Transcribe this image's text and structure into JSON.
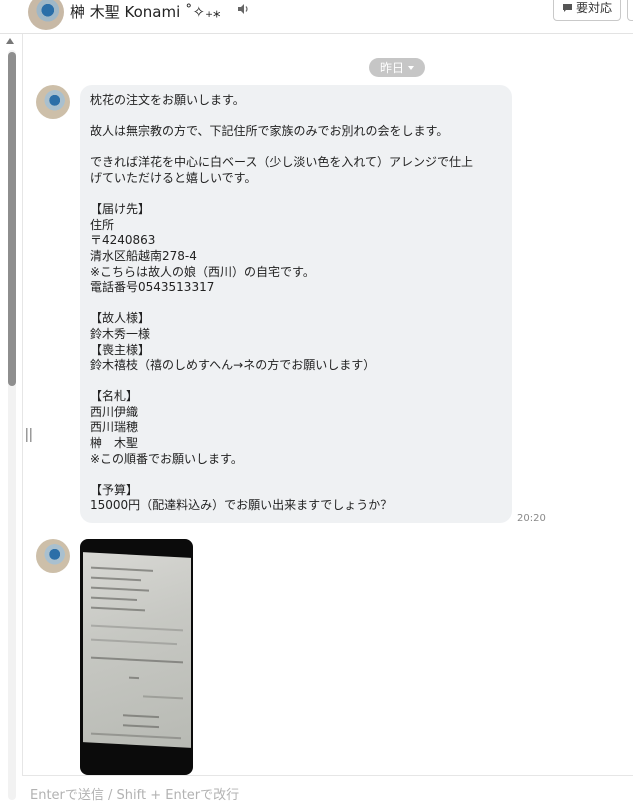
{
  "header": {
    "contact_name": "榊 木聖  Konami ˚✧₊⁎",
    "status_button_label": "要対応"
  },
  "chat": {
    "date_separator": "昨日",
    "messages": [
      {
        "lines": [
          "枕花の注文をお願いします。",
          "",
          "故人は無宗教の方で、下記住所で家族のみでお別れの会をします。",
          "",
          "できれば洋花を中心に白ベース（少し淡い色を入れて）アレンジで仕上",
          "げていただけると嬉しいです。",
          "",
          "【届け先】",
          "住所",
          "〒4240863",
          "清水区船越南278-4",
          "※こちらは故人の娘（西川）の自宅です。",
          "電話番号0543513317",
          "",
          "【故人様】",
          "鈴木秀一様",
          "【喪主様】",
          "鈴木禧枝（禧のしめすへん→ネの方でお願いします）",
          "",
          "【名札】",
          "西川伊織",
          "西川瑞穂",
          "榊　木聖",
          "※この順番でお願いします。",
          "",
          "【予算】",
          "15000円（配達料込み）でお願い出来ますでしょうか？"
        ],
        "time": "20:20"
      }
    ]
  },
  "input": {
    "placeholder": "Enterで送信 / Shift + Enterで改行"
  }
}
